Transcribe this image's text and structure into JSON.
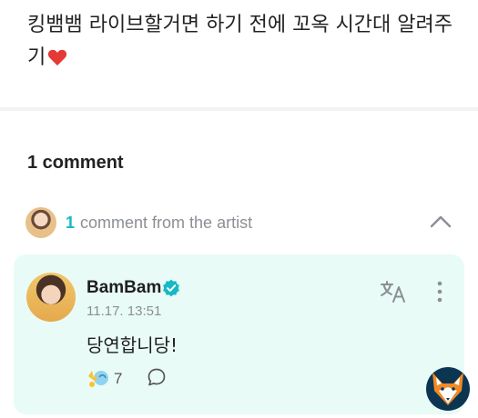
{
  "post": {
    "text": "킹뱀뱀 라이브할거면 하기 전에 꼬옥 시간대 알려주기",
    "emoji": "heart-icon"
  },
  "comments": {
    "count_label": "1 comment",
    "artist_count": "1",
    "artist_label": "comment from the artist"
  },
  "comment": {
    "author": "BamBam",
    "timestamp": "11.17. 13:51",
    "body": "당연합니당!",
    "reactions": "7"
  },
  "colors": {
    "accent": "#17b8c6",
    "card_background": "#e9fbf6",
    "heart": "#e53935"
  }
}
